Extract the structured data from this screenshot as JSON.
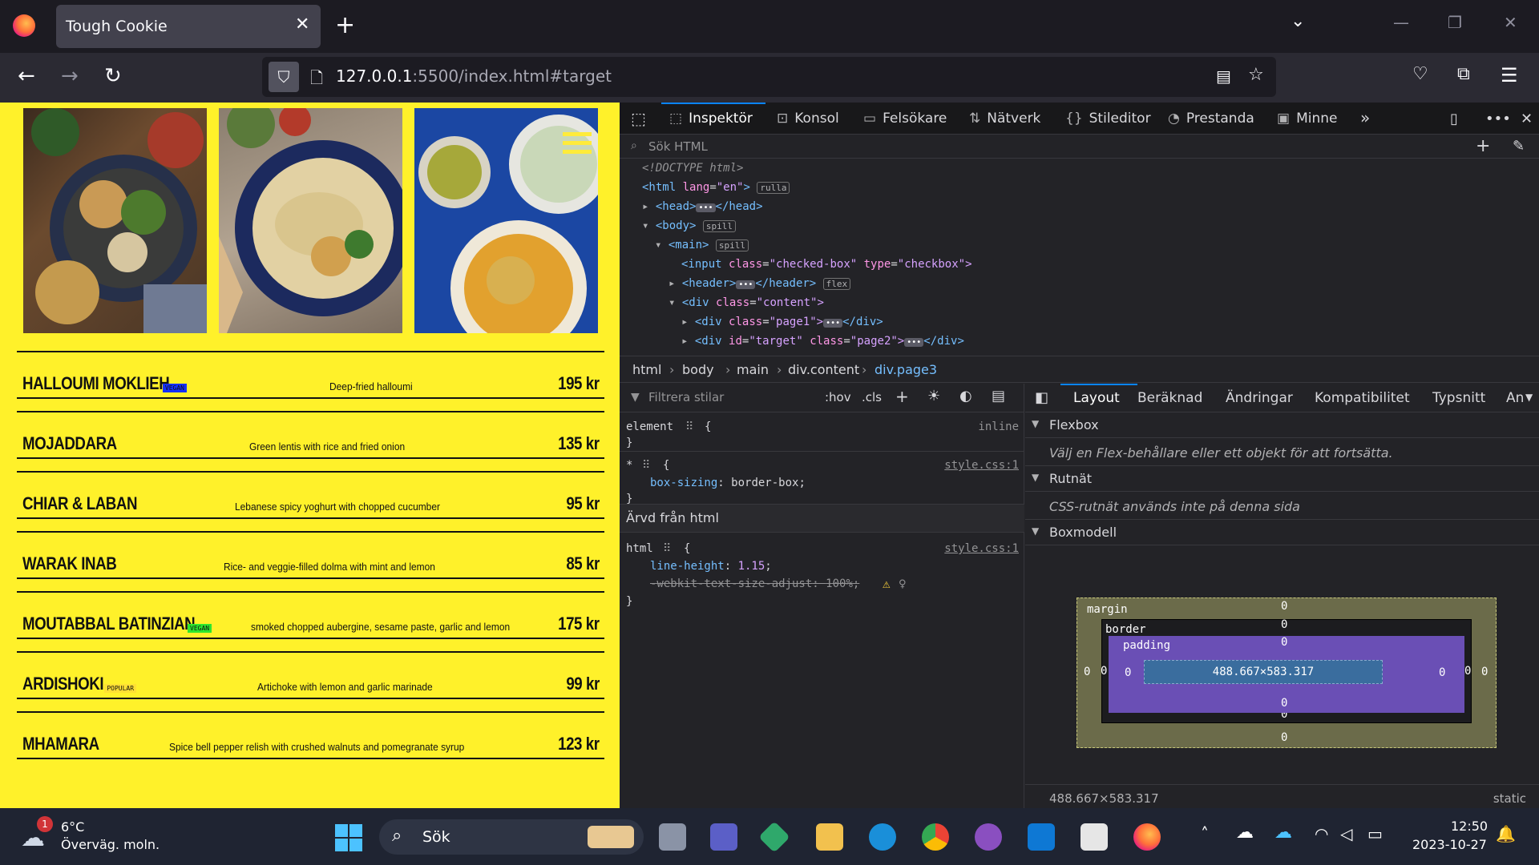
{
  "browser": {
    "tab_title": "Tough Cookie",
    "url_host": "127.0.0.1",
    "url_rest": ":5500/index.html#target"
  },
  "menu": [
    {
      "name": "HALLOUMI MOKLIEH",
      "tag": "VEGAN",
      "tag_color": "#1530ff",
      "description": "Deep-fried halloumi",
      "price": "195 kr"
    },
    {
      "name": "MOJADDARA",
      "tag": "",
      "tag_color": "",
      "description": "Green lentis with rice and fried onion",
      "price": "135 kr"
    },
    {
      "name": "CHIAR & LABAN",
      "tag": "",
      "tag_color": "",
      "description": "Lebanese spicy yoghurt with chopped cucumber",
      "price": "95 kr"
    },
    {
      "name": "WARAK INAB",
      "tag": "",
      "tag_color": "",
      "description": "Rice- and veggie-filled dolma with mint and lemon",
      "price": "85 kr"
    },
    {
      "name": "MOUTABBAL BATINZIAN",
      "tag": "VEGAN",
      "tag_color": "#2ee62e",
      "description": "smoked chopped aubergine, sesame paste, garlic and lemon",
      "price": "175 kr"
    },
    {
      "name": "ARDISHOKI",
      "tag": "POPULAR",
      "tag_color": "#ffe033",
      "description": "Artichoke with lemon and garlic marinade",
      "price": "99 kr"
    },
    {
      "name": "MHAMARA",
      "tag": "",
      "tag_color": "",
      "description": "Spice bell pepper relish with crushed walnuts and pomegranate syrup",
      "price": "123 kr"
    }
  ],
  "devtools": {
    "tabs": [
      "Inspektör",
      "Konsol",
      "Felsökare",
      "Nätverk",
      "Stileditor",
      "Prestanda",
      "Minne"
    ],
    "search_placeholder": "Sök HTML",
    "tree": {
      "doctype": "<!DOCTYPE html>",
      "html_open": "<html",
      "html_lang_attr": "lang",
      "html_lang_val": "\"en\"",
      "html_badge": "rulla",
      "head": "<head>",
      "head_close": "</head>",
      "body": "<body>",
      "body_badge": "spill",
      "main": "<main>",
      "main_badge": "spill",
      "input_tag": "<input",
      "input_class_attr": "class",
      "input_class_val": "\"checked-box\"",
      "input_type_attr": "type",
      "input_type_val": "\"checkbox\">",
      "header": "<header>",
      "header_close": "</header>",
      "header_badge": "flex",
      "div_content": "<div",
      "div_content_attr": "class",
      "div_content_val": "\"content\">",
      "div_page1": "<div",
      "div_page1_attr": "class",
      "div_page1_val": "\"page1\">",
      "div_close": "</div>",
      "div_page2": "<div",
      "div_page2_id_attr": "id",
      "div_page2_id_val": "\"target\"",
      "div_page2_class_attr": "class",
      "div_page2_class_val": "\"page2\">"
    },
    "breadcrumbs": [
      "html",
      "body",
      "main",
      "div.content",
      "div.page3"
    ],
    "rules": {
      "filter_placeholder": "Filtrera stilar",
      "hov": ":hov",
      "cls": ".cls",
      "element_selector": "element",
      "element_brace": "{",
      "element_close": "}",
      "element_inline": "inline",
      "star_selector": "*",
      "star_source": "style.css:1",
      "box_sizing_prop": "box-sizing",
      "box_sizing_val": "border-box",
      "inherited_header": "Ärvd från html",
      "html_selector": "html",
      "html_source": "style.css:1",
      "line_height_prop": "line-height",
      "line_height_val": "1.15",
      "text_size_prop": "-webkit-text-size-adjust",
      "text_size_val": "100%"
    },
    "layout_tabs": [
      "Layout",
      "Beräknad",
      "Ändringar",
      "Kompatibilitet",
      "Typsnitt",
      "An"
    ],
    "flexbox": {
      "title": "Flexbox",
      "text": "Välj en Flex-behållare eller ett objekt för att fortsätta."
    },
    "grid": {
      "title": "Rutnät",
      "text": "CSS-rutnät används inte på denna sida"
    },
    "boxmodel": {
      "title": "Boxmodell",
      "margin_label": "margin",
      "border_label": "border",
      "padding_label": "padding",
      "content_size": "488.667×583.317",
      "zero": "0",
      "footer_size": "488.667×583.317",
      "footer_position": "static"
    }
  },
  "taskbar": {
    "weather_temp": "6°C",
    "weather_desc": "Överväg. moln.",
    "weather_badge": "1",
    "search_label": "Sök",
    "time": "12:50",
    "date": "2023-10-27"
  }
}
